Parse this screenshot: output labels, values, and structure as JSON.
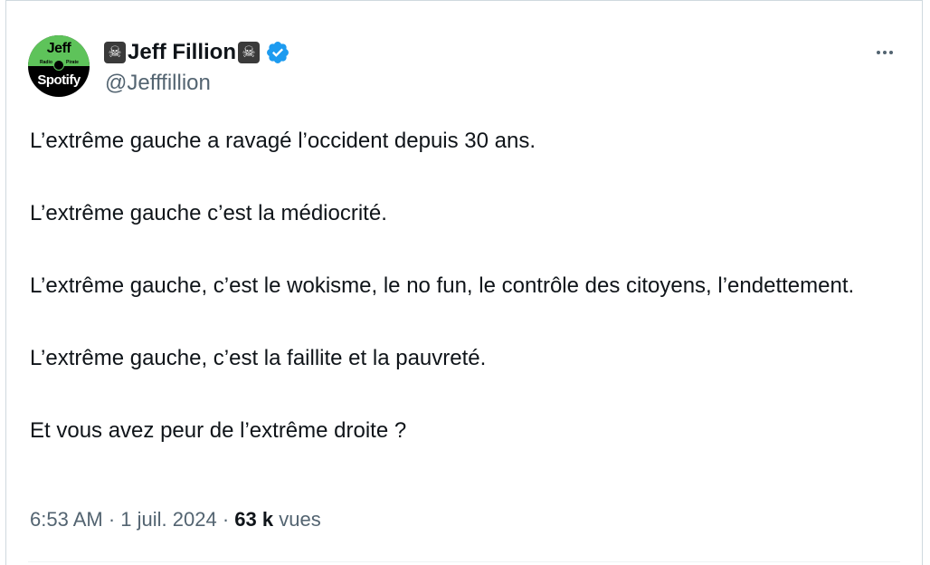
{
  "author": {
    "display_name": "Jeff Fillion",
    "handle": "@Jefffillion",
    "name_prefix_emoji": "☠",
    "name_suffix_emoji": "☠",
    "verified": true,
    "avatar": {
      "top_text": "Jeff",
      "bottom_text": "Spotify",
      "small_left": "Radio",
      "small_right": "Pirate"
    }
  },
  "tweet": {
    "paragraphs": [
      "L’extrême gauche a ravagé l’occident depuis 30 ans.",
      "L’extrême gauche c’est la médiocrité.",
      "L’extrême gauche, c’est le wokisme, le no fun, le contrôle des citoyens, l’endettement.",
      "L’extrême gauche, c’est la faillite et la pauvreté.",
      "Et vous avez peur de l’extrême droite ?"
    ],
    "time": "6:53 AM",
    "date": "1 juil. 2024",
    "separator": "·",
    "views_count": "63 k",
    "views_label": "vues"
  },
  "icons": {
    "more": "more-horizontal-icon",
    "verified": "verified-badge-icon"
  },
  "colors": {
    "verified_blue": "#1d9bf0",
    "secondary_text": "#536471",
    "primary_text": "#0f1419",
    "border": "#cfd9de"
  }
}
